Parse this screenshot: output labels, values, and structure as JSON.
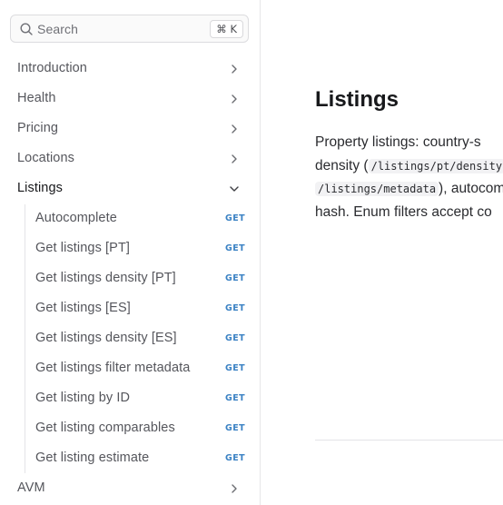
{
  "search": {
    "placeholder": "Search",
    "shortcut": "⌘ K"
  },
  "sidebar": {
    "items": [
      {
        "label": "Introduction",
        "chevron": "chevron-right"
      },
      {
        "label": "Health",
        "chevron": "chevron-right"
      },
      {
        "label": "Pricing",
        "chevron": "chevron-right"
      },
      {
        "label": "Locations",
        "chevron": "chevron-right"
      },
      {
        "label": "Listings",
        "chevron": "chevron-down",
        "active": true
      },
      {
        "label": "AVM",
        "chevron": "chevron-right"
      }
    ],
    "listings_children": [
      {
        "label": "Autocomplete",
        "method": "GET"
      },
      {
        "label": "Get listings [PT]",
        "method": "GET"
      },
      {
        "label": "Get listings density [PT]",
        "method": "GET"
      },
      {
        "label": "Get listings [ES]",
        "method": "GET"
      },
      {
        "label": "Get listings density [ES]",
        "method": "GET"
      },
      {
        "label": "Get listings filter metadata",
        "method": "GET"
      },
      {
        "label": "Get listing by ID",
        "method": "GET"
      },
      {
        "label": "Get listing comparables",
        "method": "GET"
      },
      {
        "label": "Get listing estimate",
        "method": "GET"
      }
    ]
  },
  "main": {
    "title": "Listings",
    "paragraph": {
      "line1": "Property listings: country-s",
      "line2_before": "density (",
      "line2_code": "/listings/pt/density",
      "line3_code": "/listings/metadata",
      "line3_after": "), autocom",
      "line4": "hash. Enum filters accept co"
    }
  },
  "colors": {
    "accent_method": "#3b82c4",
    "border": "#e6e6e8"
  }
}
